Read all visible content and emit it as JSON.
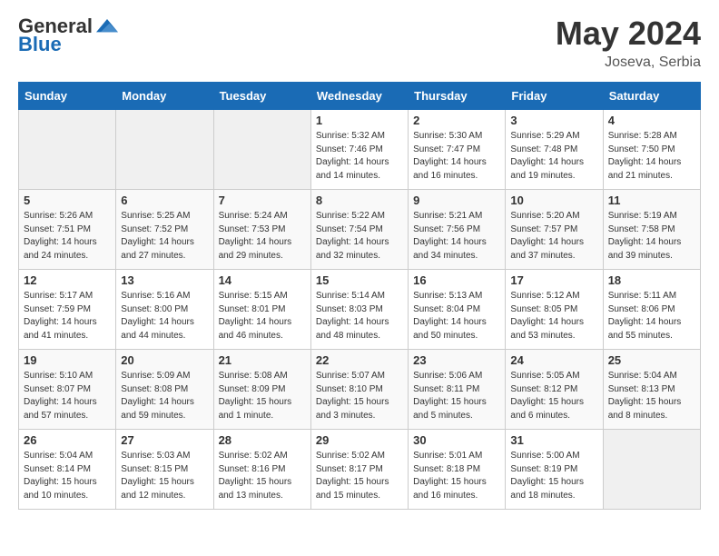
{
  "header": {
    "logo_general": "General",
    "logo_blue": "Blue",
    "month_title": "May 2024",
    "location": "Joseva, Serbia"
  },
  "weekdays": [
    "Sunday",
    "Monday",
    "Tuesday",
    "Wednesday",
    "Thursday",
    "Friday",
    "Saturday"
  ],
  "weeks": [
    [
      {
        "day": "",
        "info": ""
      },
      {
        "day": "",
        "info": ""
      },
      {
        "day": "",
        "info": ""
      },
      {
        "day": "1",
        "info": "Sunrise: 5:32 AM\nSunset: 7:46 PM\nDaylight: 14 hours\nand 14 minutes."
      },
      {
        "day": "2",
        "info": "Sunrise: 5:30 AM\nSunset: 7:47 PM\nDaylight: 14 hours\nand 16 minutes."
      },
      {
        "day": "3",
        "info": "Sunrise: 5:29 AM\nSunset: 7:48 PM\nDaylight: 14 hours\nand 19 minutes."
      },
      {
        "day": "4",
        "info": "Sunrise: 5:28 AM\nSunset: 7:50 PM\nDaylight: 14 hours\nand 21 minutes."
      }
    ],
    [
      {
        "day": "5",
        "info": "Sunrise: 5:26 AM\nSunset: 7:51 PM\nDaylight: 14 hours\nand 24 minutes."
      },
      {
        "day": "6",
        "info": "Sunrise: 5:25 AM\nSunset: 7:52 PM\nDaylight: 14 hours\nand 27 minutes."
      },
      {
        "day": "7",
        "info": "Sunrise: 5:24 AM\nSunset: 7:53 PM\nDaylight: 14 hours\nand 29 minutes."
      },
      {
        "day": "8",
        "info": "Sunrise: 5:22 AM\nSunset: 7:54 PM\nDaylight: 14 hours\nand 32 minutes."
      },
      {
        "day": "9",
        "info": "Sunrise: 5:21 AM\nSunset: 7:56 PM\nDaylight: 14 hours\nand 34 minutes."
      },
      {
        "day": "10",
        "info": "Sunrise: 5:20 AM\nSunset: 7:57 PM\nDaylight: 14 hours\nand 37 minutes."
      },
      {
        "day": "11",
        "info": "Sunrise: 5:19 AM\nSunset: 7:58 PM\nDaylight: 14 hours\nand 39 minutes."
      }
    ],
    [
      {
        "day": "12",
        "info": "Sunrise: 5:17 AM\nSunset: 7:59 PM\nDaylight: 14 hours\nand 41 minutes."
      },
      {
        "day": "13",
        "info": "Sunrise: 5:16 AM\nSunset: 8:00 PM\nDaylight: 14 hours\nand 44 minutes."
      },
      {
        "day": "14",
        "info": "Sunrise: 5:15 AM\nSunset: 8:01 PM\nDaylight: 14 hours\nand 46 minutes."
      },
      {
        "day": "15",
        "info": "Sunrise: 5:14 AM\nSunset: 8:03 PM\nDaylight: 14 hours\nand 48 minutes."
      },
      {
        "day": "16",
        "info": "Sunrise: 5:13 AM\nSunset: 8:04 PM\nDaylight: 14 hours\nand 50 minutes."
      },
      {
        "day": "17",
        "info": "Sunrise: 5:12 AM\nSunset: 8:05 PM\nDaylight: 14 hours\nand 53 minutes."
      },
      {
        "day": "18",
        "info": "Sunrise: 5:11 AM\nSunset: 8:06 PM\nDaylight: 14 hours\nand 55 minutes."
      }
    ],
    [
      {
        "day": "19",
        "info": "Sunrise: 5:10 AM\nSunset: 8:07 PM\nDaylight: 14 hours\nand 57 minutes."
      },
      {
        "day": "20",
        "info": "Sunrise: 5:09 AM\nSunset: 8:08 PM\nDaylight: 14 hours\nand 59 minutes."
      },
      {
        "day": "21",
        "info": "Sunrise: 5:08 AM\nSunset: 8:09 PM\nDaylight: 15 hours\nand 1 minute."
      },
      {
        "day": "22",
        "info": "Sunrise: 5:07 AM\nSunset: 8:10 PM\nDaylight: 15 hours\nand 3 minutes."
      },
      {
        "day": "23",
        "info": "Sunrise: 5:06 AM\nSunset: 8:11 PM\nDaylight: 15 hours\nand 5 minutes."
      },
      {
        "day": "24",
        "info": "Sunrise: 5:05 AM\nSunset: 8:12 PM\nDaylight: 15 hours\nand 6 minutes."
      },
      {
        "day": "25",
        "info": "Sunrise: 5:04 AM\nSunset: 8:13 PM\nDaylight: 15 hours\nand 8 minutes."
      }
    ],
    [
      {
        "day": "26",
        "info": "Sunrise: 5:04 AM\nSunset: 8:14 PM\nDaylight: 15 hours\nand 10 minutes."
      },
      {
        "day": "27",
        "info": "Sunrise: 5:03 AM\nSunset: 8:15 PM\nDaylight: 15 hours\nand 12 minutes."
      },
      {
        "day": "28",
        "info": "Sunrise: 5:02 AM\nSunset: 8:16 PM\nDaylight: 15 hours\nand 13 minutes."
      },
      {
        "day": "29",
        "info": "Sunrise: 5:02 AM\nSunset: 8:17 PM\nDaylight: 15 hours\nand 15 minutes."
      },
      {
        "day": "30",
        "info": "Sunrise: 5:01 AM\nSunset: 8:18 PM\nDaylight: 15 hours\nand 16 minutes."
      },
      {
        "day": "31",
        "info": "Sunrise: 5:00 AM\nSunset: 8:19 PM\nDaylight: 15 hours\nand 18 minutes."
      },
      {
        "day": "",
        "info": ""
      }
    ]
  ]
}
